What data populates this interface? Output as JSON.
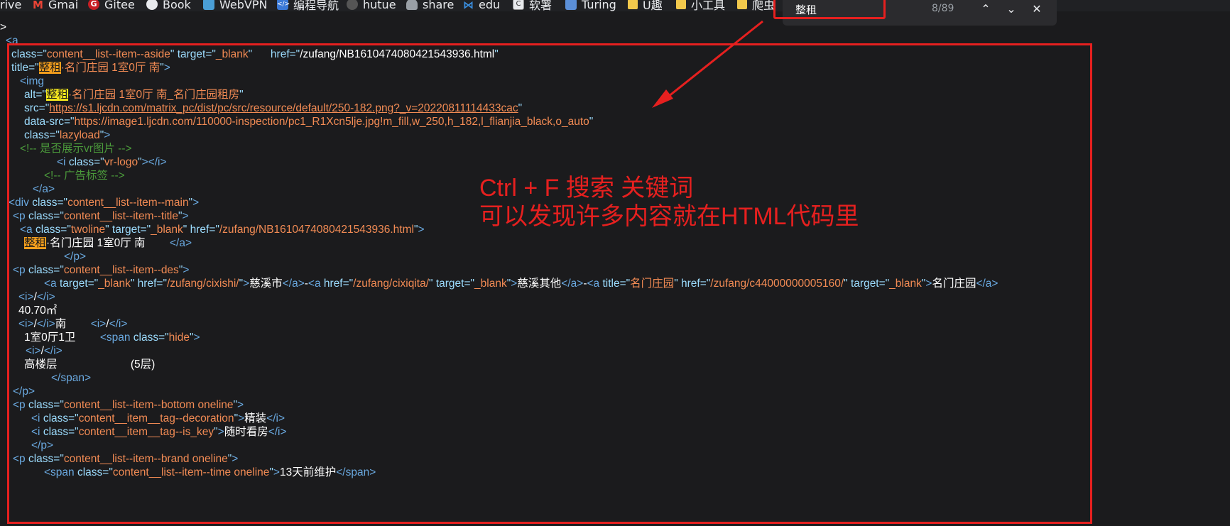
{
  "bookmarks": [
    {
      "label": "rive",
      "icon": "none"
    },
    {
      "label": "Gmai",
      "icon": "gmail-icon"
    },
    {
      "label": "Gitee",
      "icon": "gitee-icon"
    },
    {
      "label": "Book",
      "icon": "github-icon"
    },
    {
      "label": "WebVPN",
      "icon": "webvpn-icon"
    },
    {
      "label": "编程导航",
      "icon": "code-nav-icon"
    },
    {
      "label": "hutue",
      "icon": "hutue-icon"
    },
    {
      "label": "share",
      "icon": "share-icon"
    },
    {
      "label": "edu",
      "icon": "edu-icon"
    },
    {
      "label": "软署",
      "icon": "software-icon"
    },
    {
      "label": "Turing",
      "icon": "turing-icon"
    },
    {
      "label": "U趣",
      "icon": "folder-icon"
    },
    {
      "label": "小工具",
      "icon": "folder-icon"
    },
    {
      "label": "爬虫",
      "icon": "folder-icon"
    }
  ],
  "find": {
    "query": "整租",
    "count": "8/89",
    "prev_icon": "chevron-up-icon",
    "next_icon": "chevron-down-icon",
    "close_icon": "close-icon"
  },
  "code_lines": [
    ">",
    "<a",
    "class=\"content__list--item--aside\" target=\"_blank\"      href=\"/zufang/NB1610474080421543936.html\"",
    "title=\"整租·名门庄园 1室0厅 南\">",
    "<img",
    "alt=\"整租·名门庄园 1室0厅 南_名门庄园租房\"",
    "src=\"https://s1.ljcdn.com/matrix_pc/dist/pc/src/resource/default/250-182.png?_v=20220811114433cac\"",
    "data-src=\"https://image1.ljcdn.com/110000-inspection/pc1_R1Xcn5lje.jpg!m_fill,w_250,h_182,l_flianjia_black,o_auto\"",
    "class=\"lazyload\">",
    "<!-- 是否展示vr图片 -->",
    "<i class=\"vr-logo\"></i>",
    "<!-- 广告标签 -->",
    "</a>",
    "<div class=\"content__list--item--main\">",
    "<p class=\"content__list--item--title\">",
    "<a class=\"twoline\" target=\"_blank\" href=\"/zufang/NB1610474080421543936.html\">",
    "整租·名门庄园 1室0厅 南        </a>",
    "</p>",
    "<p class=\"content__list--item--des\">",
    "<a target=\"_blank\" href=\"/zufang/cixishi/\">慈溪市</a>-<a href=\"/zufang/cixiqita/\" target=\"_blank\">慈溪其他</a>-<a title=\"名门庄园\" href=\"/zufang/c44000000005160/\" target=\"_blank\">名门庄园</a>",
    "<i>/</i>",
    "40.70㎡",
    "<i>/</i>南        <i>/</i>",
    "1室0厅1卫        <span class=\"hide\">",
    "<i>/</i>",
    "高楼层                        (5层)",
    "</span>",
    "</p>",
    "<p class=\"content__list--item--bottom oneline\">",
    "<i class=\"content__item__tag--decoration\">精装</i>",
    "<i class=\"content__item__tag--is_key\">随时看房</i>",
    "</p>",
    "<p class=\"content__list--item--brand oneline\">",
    "<span class=\"content__list--item--time oneline\">13天前维护</span>"
  ],
  "annotation": {
    "line1": "Ctrl + F 搜索 关键词",
    "line2": "可以发现许多内容就在HTML代码里"
  },
  "colors": {
    "background": "#1b1b1d",
    "tag": "#6aa9e0",
    "attribute": "#9cdcfe",
    "value": "#f28b54",
    "comment": "#4b9a3b",
    "match_highlight": "#f5e81d",
    "current_match": "#f59f1d",
    "annotation_red": "#e6201f"
  }
}
